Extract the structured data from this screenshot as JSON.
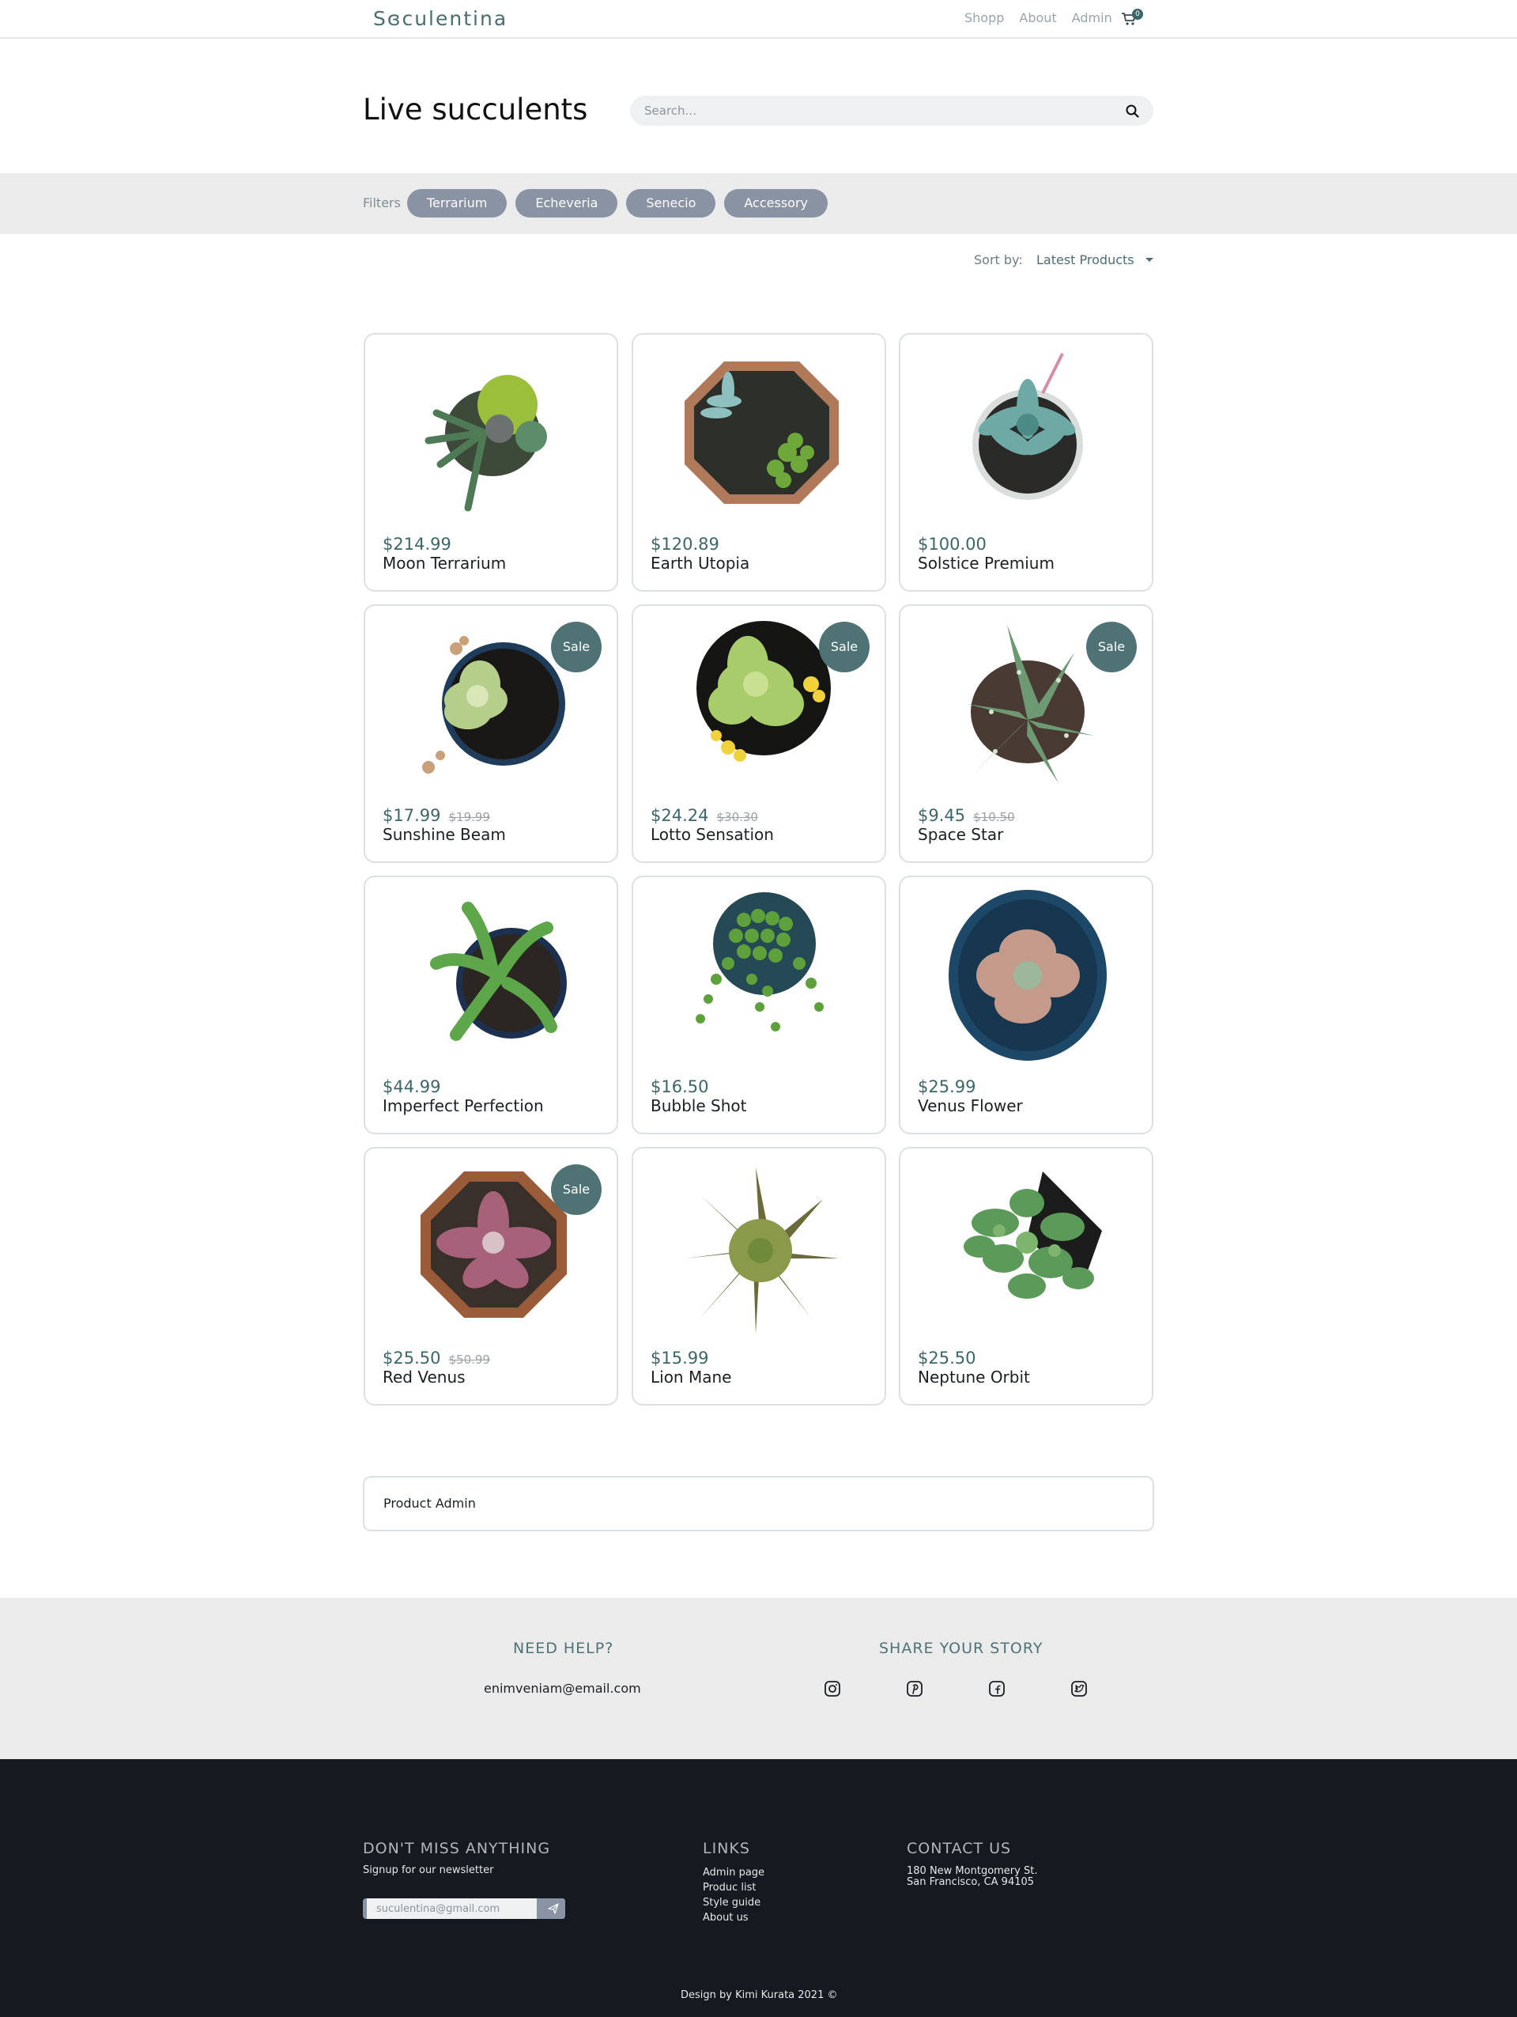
{
  "navbar": {
    "logo": "Sɞculentina",
    "links": [
      "Shopp",
      "About",
      "Admin"
    ],
    "cart_count": "0"
  },
  "hero": {
    "title": "Live succulents",
    "search_placeholder": "Search..."
  },
  "filters": {
    "label": "Filters",
    "chips": [
      "Terrarium",
      "Echeveria",
      "Senecio",
      "Accessory"
    ]
  },
  "sort": {
    "label": "Sort by:",
    "value": "Latest Products"
  },
  "products": [
    {
      "price": "$214.99",
      "old_price": "",
      "name": "Moon Terrarium",
      "sale": false
    },
    {
      "price": "$120.89",
      "old_price": "",
      "name": "Earth Utopia",
      "sale": false
    },
    {
      "price": "$100.00",
      "old_price": "",
      "name": "Solstice Premium",
      "sale": false
    },
    {
      "price": "$17.99",
      "old_price": "$19.99",
      "name": "Sunshine Beam",
      "sale": true
    },
    {
      "price": "$24.24",
      "old_price": "$30.30",
      "name": "Lotto Sensation",
      "sale": true
    },
    {
      "price": "$9.45",
      "old_price": "$10.50",
      "name": "Space Star",
      "sale": true
    },
    {
      "price": "$44.99",
      "old_price": "",
      "name": "Imperfect Perfection",
      "sale": false
    },
    {
      "price": "$16.50",
      "old_price": "",
      "name": "Bubble Shot",
      "sale": false
    },
    {
      "price": "$25.99",
      "old_price": "",
      "name": "Venus Flower",
      "sale": false
    },
    {
      "price": "$25.50",
      "old_price": "$50.99",
      "name": "Red Venus",
      "sale": true
    },
    {
      "price": "$15.99",
      "old_price": "",
      "name": "Lion Mane",
      "sale": false
    },
    {
      "price": "$25.50",
      "old_price": "",
      "name": "Neptune Orbit",
      "sale": false
    }
  ],
  "sale_label": "Sale",
  "admin": {
    "label": "Product Admin"
  },
  "help": {
    "title": "NEED HELP?",
    "email": "enimveniam@email.com",
    "share_title": "SHARE YOUR STORY",
    "social_icons": [
      "instagram-icon",
      "pinterest-icon",
      "facebook-icon",
      "twitter-icon"
    ]
  },
  "footer": {
    "newsletter_title": "DON'T MISS ANYTHING",
    "newsletter_text": "Signup for our newsletter",
    "newsletter_placeholder": "suculentina@gmail.com",
    "links_title": "LINKS",
    "links": [
      "Admin page",
      "Produc list",
      "Style guide",
      "About us"
    ],
    "contact_title": "CONTACT US",
    "contact_line1": "180 New Montgomery St.",
    "contact_line2": "San Francisco, CA 94105",
    "credit": "Design by Kimi Kurata 2021 ©"
  },
  "colors": {
    "accent": "#4f7375",
    "chip": "#8993a3",
    "footer_dark": "#161920",
    "light_band": "#ebebeb"
  }
}
